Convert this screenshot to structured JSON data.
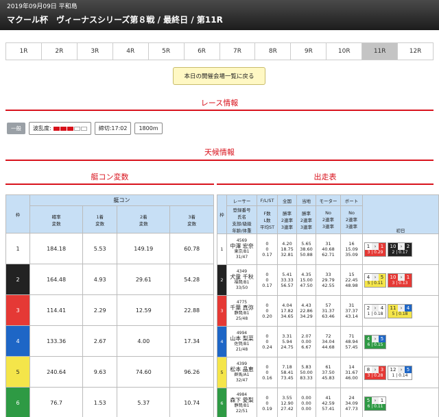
{
  "header": {
    "date": "2019年09月09日 平和島",
    "title": "マクール杯　ヴィーナスシリーズ第８戦 / 最終日 / 第11R"
  },
  "tabs": [
    "1R",
    "2R",
    "3R",
    "4R",
    "5R",
    "6R",
    "7R",
    "8R",
    "9R",
    "10R",
    "11R",
    "12R"
  ],
  "active_tab": "11R",
  "back_button": "本日の開催会場一覧に戻る",
  "race_info": {
    "section_title": "レース情報",
    "badge": "一般",
    "wave_label": "波乱度:",
    "wave_level": 3,
    "wave_max": 5,
    "deadline": "締切:17:02",
    "distance": "1800m"
  },
  "weather": {
    "section_title": "天候情報"
  },
  "left": {
    "section_title": "艇コン変数",
    "group_header": "艇コン",
    "lane_header": "枠",
    "col_headers": [
      "確率\n変数",
      "1着\n変数",
      "2着\n変数",
      "3着\n変数"
    ],
    "rows": [
      {
        "lane": "1",
        "v": [
          "184.18",
          "5.53",
          "149.19",
          "60.78"
        ]
      },
      {
        "lane": "2",
        "v": [
          "164.48",
          "4.93",
          "29.61",
          "54.28"
        ]
      },
      {
        "lane": "3",
        "v": [
          "114.41",
          "2.29",
          "12.59",
          "22.88"
        ]
      },
      {
        "lane": "4",
        "v": [
          "133.36",
          "2.67",
          "4.00",
          "17.34"
        ]
      },
      {
        "lane": "5",
        "v": [
          "240.64",
          "9.63",
          "74.60",
          "96.26"
        ]
      },
      {
        "lane": "6",
        "v": [
          "76.7",
          "1.53",
          "5.37",
          "10.74"
        ]
      }
    ]
  },
  "right": {
    "section_title": "出走表",
    "headers": {
      "lane": "枠",
      "racer": "レーサー",
      "racer_sub": "登録番号\n氏名\n支部/級級\n年齢/体重",
      "fls": "F/L/ST",
      "fls_sub": "F数\nL数\n平均ST",
      "national": "全国",
      "national_sub": "勝率\n2連率\n3連率",
      "local": "当地",
      "local_sub": "勝率\n2連率\n3連率",
      "motor": "モーター",
      "motor_sub": "No\n2連率\n3連率",
      "boat": "ボート",
      "boat_sub": "No\n2連率\n3連率",
      "day1": "初日"
    },
    "rows": [
      {
        "lane": "1",
        "id": "4569",
        "name": "中澤 宏奈",
        "branch": "東京/B1",
        "age": "31/47",
        "fls": [
          "0",
          "0",
          "0.17"
        ],
        "nat": [
          "4.20",
          "18.75",
          "32.81"
        ],
        "loc": [
          "5.65",
          "38.60",
          "50.88"
        ],
        "motor": [
          "31",
          "40.68",
          "62.71"
        ],
        "boat": [
          "16",
          "15.09",
          "35.09"
        ],
        "ex": [
          {
            "a": "1",
            "ac": "c1",
            "b": "1",
            "bc": "c3",
            "t": "3 | 0.29",
            "tc": "c3"
          },
          {
            "a": "10",
            "ac": "c2",
            "b": "2",
            "bc": "c2",
            "t": "2 | 0.17",
            "tc": "c2"
          }
        ]
      },
      {
        "lane": "2",
        "id": "4349",
        "name": "犬童 千秋",
        "branch": "福岡/B1",
        "age": "33/50",
        "fls": [
          "0",
          "0",
          "0.17"
        ],
        "nat": [
          "5.41",
          "33.33",
          "56.57"
        ],
        "loc": [
          "4.35",
          "15.00",
          "47.50"
        ],
        "motor": [
          "33",
          "29.79",
          "42.55"
        ],
        "boat": [
          "15",
          "22.45",
          "48.98"
        ],
        "ex": [
          {
            "a": "4",
            "ac": "c1",
            "b": "5",
            "bc": "c5",
            "t": "5 | 0.11",
            "tc": "c5"
          },
          {
            "a": "10",
            "ac": "c3",
            "b": "1",
            "bc": "c3",
            "t": "3 | 0.13",
            "tc": "c3"
          }
        ]
      },
      {
        "lane": "3",
        "id": "4775",
        "name": "千葉 真弥",
        "branch": "静岡/B1",
        "age": "25/48",
        "fls": [
          "0",
          "0",
          "0.20"
        ],
        "nat": [
          "4.04",
          "17.82",
          "34.65"
        ],
        "loc": [
          "4.43",
          "22.86",
          "34.29"
        ],
        "motor": [
          "57",
          "31.37",
          "63.46"
        ],
        "boat": [
          "31",
          "37.37",
          "43.14"
        ],
        "ex": [
          {
            "a": "2",
            "ac": "c1",
            "b": "4",
            "bc": "c1",
            "t": "1 | 0.18",
            "tc": "c1"
          },
          {
            "a": "11",
            "ac": "c5",
            "b": "4",
            "bc": "c4",
            "t": "5 | 0.18",
            "tc": "c5"
          }
        ]
      },
      {
        "lane": "4",
        "id": "4994",
        "name": "山本 梨菜",
        "branch": "佐賀/B1",
        "age": "21/48",
        "fls": [
          "0",
          "0",
          "0.24"
        ],
        "nat": [
          "3.31",
          "5.94",
          "24.75"
        ],
        "loc": [
          "2.07",
          "0.00",
          "6.67"
        ],
        "motor": [
          "72",
          "34.04",
          "44.68"
        ],
        "boat": [
          "71",
          "48.94",
          "57.45"
        ],
        "ex": [
          {
            "a": "4",
            "ac": "c6",
            "b": "5",
            "bc": "c4",
            "t": "6 | 0.15",
            "tc": "c6"
          }
        ]
      },
      {
        "lane": "5",
        "id": "4399",
        "name": "松本 晶恵",
        "branch": "群馬/A1",
        "age": "32/47",
        "fls": [
          "0",
          "0",
          "0.16"
        ],
        "nat": [
          "7.18",
          "58.41",
          "73.45"
        ],
        "loc": [
          "5.83",
          "50.00",
          "83.33"
        ],
        "motor": [
          "61",
          "37.50",
          "45.83"
        ],
        "boat": [
          "14",
          "31.67",
          "46.00"
        ],
        "ex": [
          {
            "a": "8",
            "ac": "c1",
            "b": "3",
            "bc": "c3",
            "t": "3 | 0.28",
            "tc": "c3"
          },
          {
            "a": "12",
            "ac": "c1",
            "b": "5",
            "bc": "c4",
            "t": "1 | 0.14",
            "tc": "c1"
          }
        ]
      },
      {
        "lane": "6",
        "id": "4984",
        "name": "森下 愛梨",
        "branch": "静岡/B1",
        "age": "22/51",
        "fls": [
          "0",
          "0",
          "0.19"
        ],
        "nat": [
          "3.55",
          "12.90",
          "27.42"
        ],
        "loc": [
          "0.00",
          "0.00",
          "0.00"
        ],
        "motor": [
          "41",
          "42.59",
          "57.41"
        ],
        "boat": [
          "24",
          "34.09",
          "47.73"
        ],
        "ex": [
          {
            "a": "5",
            "ac": "c6",
            "b": "1",
            "bc": "c1",
            "t": "6 | 0.11",
            "tc": "c6"
          }
        ]
      }
    ]
  }
}
